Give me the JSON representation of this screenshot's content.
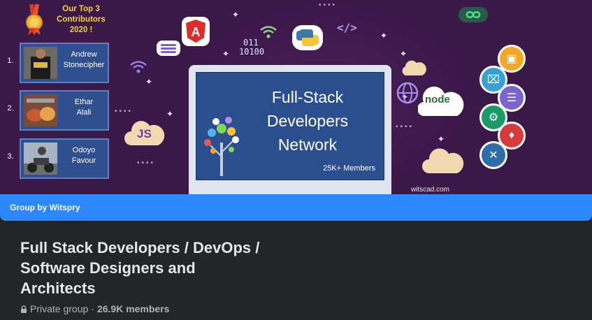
{
  "cover": {
    "contributors_heading": [
      "Our Top 3",
      "Contributors",
      "2020 !"
    ],
    "contributors": [
      {
        "rank": "1.",
        "name_lines": [
          "Andrew",
          "Stonecipher"
        ]
      },
      {
        "rank": "2.",
        "name_lines": [
          "Ethar",
          "Alali"
        ]
      },
      {
        "rank": "3.",
        "name_lines": [
          "Odoyo",
          "Favour"
        ]
      }
    ],
    "screen_title": [
      "Full-Stack",
      "Developers",
      "Network"
    ],
    "screen_members": "25K+ Members",
    "binary": [
      "011",
      "10100"
    ],
    "code_tag": "</>",
    "js_label": "JS",
    "node_label": "node",
    "watermark": "witscad.com",
    "colors": {
      "background": "#3a1848",
      "screen": "#2b4f8e",
      "accent_yellow": "#f4d13a"
    }
  },
  "group_bar": {
    "label": "Group by Witspry"
  },
  "group": {
    "title_lines": [
      "Full Stack Developers / DevOps /",
      "Software Designers and",
      "Architects"
    ],
    "privacy": "Private group",
    "separator": "·",
    "members": "26.9K members"
  },
  "icons": {
    "privacy": "lock-icon",
    "medal": "medal-icon",
    "angular": "angular-icon",
    "python": "python-icon",
    "wifi": "wifi-icon",
    "globe": "globe-icon",
    "server": "database-icon"
  }
}
